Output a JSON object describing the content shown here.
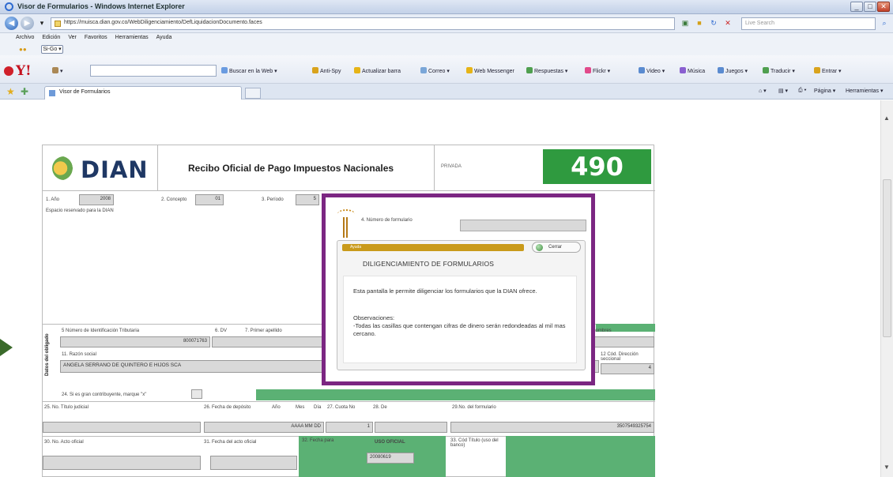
{
  "window": {
    "title": "Visor de Formularios - Windows Internet Explorer",
    "min": "_",
    "max": "□",
    "close": "✕"
  },
  "address": {
    "url": "https://muisca.dian.gov.co/WebDiligenciamiento/DefLiquidacionDocumento.faces",
    "search_placeholder": "Live Search"
  },
  "menu": [
    "Archivo",
    "Edición",
    "Ver",
    "Favoritos",
    "Herramientas",
    "Ayuda"
  ],
  "toolbar1": {
    "label": "Si-Go ▾"
  },
  "yahoo_toolbar": {
    "logo": "Y!",
    "items": [
      "Buscar en la Web ▾",
      "Anti-Spy",
      "Actualizar barra",
      "Correo ▾",
      "Web Messenger",
      "Respuestas ▾",
      "Flickr ▾",
      "Video ▾",
      "Música",
      "Juegos ▾",
      "Traducir ▾",
      "Entrar ▾"
    ]
  },
  "tabs": {
    "active": "Visor de Formularios"
  },
  "commands": [
    "Página ▾",
    "Herramientas ▾"
  ],
  "form": {
    "logo": "DIAN",
    "title": "Recibo Oficial de Pago Impuestos Nacionales",
    "privacy": "PRIVADA",
    "number": "490",
    "fields": {
      "anio_label": "1. Año",
      "anio_value": "2008",
      "concepto_label": "2. Concepto",
      "concepto_value": "01",
      "periodo_label": "3. Período",
      "periodo_value": "5",
      "reservado": "Espacio reservado para la DIAN",
      "nit_label": "5 Número de Identificación Tributaria",
      "nit_value": "800071763",
      "dv_label": "6. DV",
      "apellido_label": "7. Primer apellido",
      "nombres_label": "Otros nombres",
      "razon_label": "11. Razón social",
      "razon_value": "ANGELA SERRANO DE QUINTERO E HIJOS SCA",
      "direccion_label": "12 Cód. Dirección seccional",
      "direccion_value": "4",
      "datos_label": "Datos del obligado",
      "contrib_label": "24. Si es gran contribuyente, marque \"x\"",
      "titulo_label": "25. No. Título judicial",
      "fecha_dep_label": "26. Fecha de depósito",
      "aaa_label": "Año",
      "mes_label": "Mes",
      "dia_label": "Día",
      "fecha_dep_value": "AAAA  MM  DD",
      "cuota_label": "27. Cuota No",
      "de_label": "28. De",
      "cuota_value": "1",
      "formulario_label": "29.No. del formulario",
      "formulario_value": "3507549325754",
      "acto_label": "30. No. Acto oficial",
      "fecha_acto_label": "31. Fecha del acto oficial",
      "fecha_para_label": "32. Fecha para",
      "uso_label": "USO OFICIAL",
      "uso_value": "20080619",
      "cod_titulo_label": "33. Cód Título (uso del banco)"
    }
  },
  "modal": {
    "num_label": "4. Número de formulario",
    "bar_label": "Ayuda",
    "close_label": "Cerrar",
    "heading": "DILIGENCIAMIENTO DE FORMULARIOS",
    "p1": "Esta pantalla le permite diligenciar los formularios que la DIAN ofrece.",
    "p2_title": "Observaciones:",
    "p2": "-Todas las casillas que contengan cifras de dinero serán redondeadas al mil mas cercano."
  },
  "colors": {
    "accent_green": "#2f9a3f",
    "highlight_purple": "#7b2682",
    "gold": "#c99a1a"
  }
}
